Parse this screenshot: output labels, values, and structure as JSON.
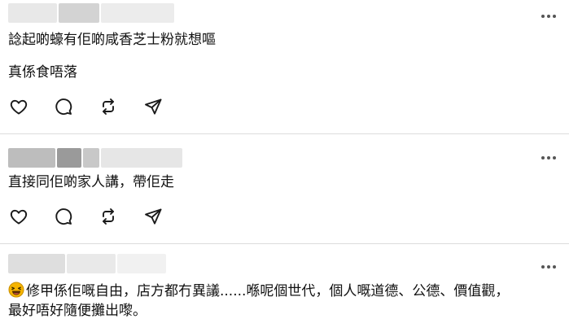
{
  "posts": [
    {
      "author": "",
      "lines": [
        "諗起啲蠔有佢啲咸香芝士粉就想嘔",
        "真係食唔落"
      ],
      "actions": [
        "heart-icon",
        "comment-icon",
        "repost-icon",
        "share-icon"
      ]
    },
    {
      "author": "",
      "lines": [
        "直接同佢啲家人講，帶佢走"
      ],
      "actions": [
        "heart-icon",
        "comment-icon",
        "repost-icon",
        "share-icon"
      ]
    },
    {
      "author": "",
      "emoji": "laughing-face-icon",
      "lines": [
        "修甲係佢嘅自由，店方都冇異議......喺呢個世代，個人嘅道德、公德、價值觀，",
        "最好唔好隨便攤出嚟。"
      ]
    }
  ],
  "colors": {
    "divider": "#dcdcdc",
    "text": "#111111",
    "icon": "#1a1a1a",
    "emoji": "#f5b400"
  }
}
